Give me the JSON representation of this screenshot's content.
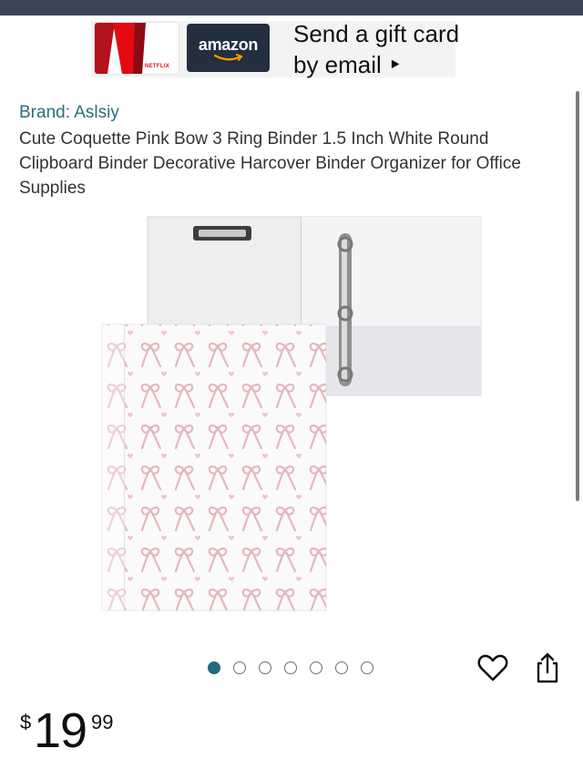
{
  "ad": {
    "netflix_label": "NETFLIX",
    "amazon_label": "amazon",
    "headline_line1": "Send a gift card",
    "headline_line2": "by email ‣"
  },
  "product": {
    "brand": "Brand: Aslsiy",
    "title": "Cute Coquette Pink Bow 3 Ring Binder 1.5 Inch White Round Clipboard Binder Decorative Harcover Binder Organizer for Office Supplies",
    "image_description_name": "pink-bow-binder"
  },
  "carousel": {
    "total": 7,
    "active_index": 0
  },
  "price": {
    "symbol": "$",
    "whole": "19",
    "fraction": "99"
  },
  "icons": {
    "wishlist": "heart-icon",
    "share": "share-icon"
  },
  "colors": {
    "brand_link": "#2a6f7e",
    "active_dot": "#1f6b80",
    "top_bar": "#3a4655",
    "amazon_card": "#232f3e"
  }
}
